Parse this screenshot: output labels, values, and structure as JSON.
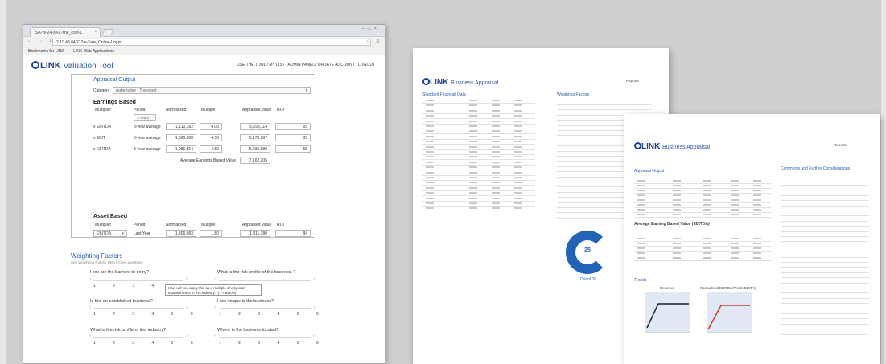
{
  "browser": {
    "tab_title": "SA-W-24-XXX-fine_cont-L",
    "url": "2.10.48.84.217/e-Sale_Online-Login",
    "bookmarks": [
      "Bookmarks for LINK",
      "LINK Web Applications"
    ]
  },
  "app": {
    "logo_text": "LINK",
    "tool_name": "Valuation Tool",
    "top_nav": "USE THE TOOL  /  MY LIST  /  ADMIN PANEL  /  UPDATE ACCOUNT  /  LOGOUT"
  },
  "appraisal": {
    "section_title": "Appraisal Output",
    "category_label": "Category",
    "category_value": "Automotive - Transport",
    "earnings_title": "Earnings Based",
    "headers": [
      "Multiplier",
      "Period",
      "Normalised",
      "Multiple",
      "Appraised Value",
      "ROI"
    ],
    "period_selector": "3 Years",
    "rows": [
      {
        "multiplier": "x EBITDA",
        "period": "3-year average",
        "normalised": "1,110,182",
        "multiple": "4.00",
        "value": "5,696,114",
        "roi": "55"
      },
      {
        "multiplier": "x EBIT",
        "period": "3-year average",
        "normalised": "1,066,808",
        "multiple": "4.50",
        "value": "5,178,987",
        "roi": "35"
      },
      {
        "multiplier": "x EBITDA",
        "period": "3-year average",
        "normalised": "1,086,504",
        "multiple": "4.80",
        "value": "5,236,589",
        "roi": "55"
      }
    ],
    "average_label": "Average Earnings Based Value",
    "average_value": "7,162,205",
    "asset_title": "Asset Based",
    "asset_row": {
      "multiplier": "EBITDA",
      "period": "Last Year",
      "normalised": "1,306,883",
      "multiple": "1.80",
      "value": "1,811,180",
      "roi": "84"
    }
  },
  "weighting": {
    "title": "Weighting Factors",
    "subtitle": "See Weighting Rules  |  Help  |  Clear questions",
    "tooltip": "How will you apply this as a multiple of a typical establishment in this industry? (1 = Below)",
    "questions": [
      "How are the barriers to entry?",
      "What is the risk profile of the business ?",
      "Is this an established business?",
      "How unique is the business?",
      "What is the risk profile of this industry?",
      "Where is the business located?"
    ],
    "ticks": "1 2 3 4 5 6"
  },
  "report_a": {
    "logo_text": "LINK",
    "title": "Business Appraisal",
    "corner_tag": "Reports",
    "left_heading": "Standard Financial Data",
    "right_heading": "Weighting Factors",
    "score": "25",
    "score_label": "Out of 35"
  },
  "report_b": {
    "logo_text": "LINK",
    "title": "Business Appraisal",
    "corner_tag": "Reports",
    "left_heading": "Appraisal Output",
    "right_heading": "Comments and Further Considerations",
    "average_label": "Average Earning Based Value (EBITDA)",
    "trends_heading": "Trends",
    "chart1_title": "Revenue",
    "chart2_title": "Normalised EBITDA/Profit (EBITA)"
  },
  "colors": {
    "brand": "#1d3f8f",
    "accent": "#2c5aa8",
    "trend_black": "#222222",
    "trend_red": "#d23a2a"
  }
}
